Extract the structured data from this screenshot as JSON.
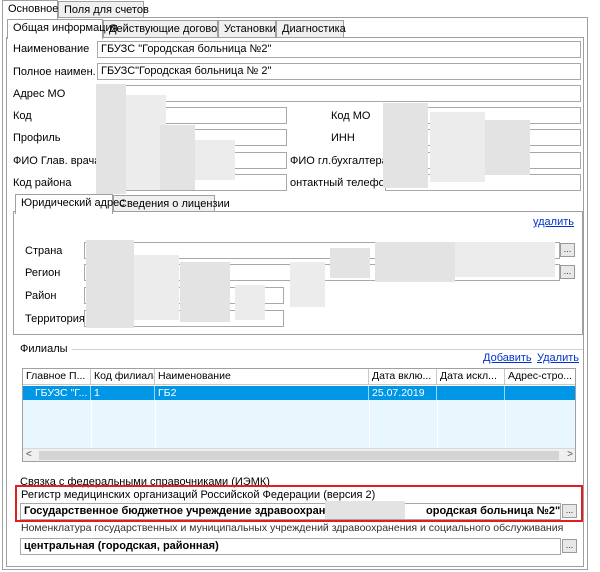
{
  "top_tabs": [
    "Основное",
    "Поля для счетов"
  ],
  "sub_tabs": [
    "Общая информация",
    "Действующие договоры",
    "Установки",
    "Диагностика"
  ],
  "general": {
    "name_label": "Наименование",
    "name_value": "ГБУЗС \"Городская больница №2\"",
    "full_name_label": "Полное наимен.",
    "full_name_value": "ГБУЗС\"Городская больница № 2\"",
    "address_label": "Адрес МО",
    "code_label": "Код",
    "profile_label": "Профиль",
    "chief_label": "ФИО Глав. врача",
    "district_label": "Код района",
    "mo_code_label": "Код МО",
    "inn_label": "ИНН",
    "accountant_label": "ФИО гл.бухгалтера",
    "phone_label": "онтактный телефон"
  },
  "address_tabs": [
    "Юридический адрес",
    "Сведения о лицензии"
  ],
  "address": {
    "delete_link": "удалить",
    "country_label": "Страна",
    "region_label": "Регион",
    "area_label": "Район",
    "territory_label": "Территория"
  },
  "branches": {
    "title": "Филиалы",
    "add_link": "Добавить",
    "delete_link": "Удалить",
    "columns": [
      "Главное П...",
      "Код филиала",
      "Наименование",
      "Дата вклю...",
      "Дата искл...",
      "Адрес-стро..."
    ],
    "rows": [
      [
        "ГБУЗС \"Г...",
        "1",
        "ГБ2",
        "25.07.2019",
        "",
        ""
      ]
    ]
  },
  "iemk": {
    "section_label": "Связка с федеральными справочниками (ИЭМК)",
    "registry_label": "Регистр медицинских организаций Российской Федерации (версия 2)",
    "registry_value_start": "Государственное бюджетное учреждение здравоохранени",
    "registry_value_end": "ородская больница №2\"",
    "nomenclature_label": "Номенклатура государственных и муниципальных учреждений здравоохранения и социального обслуживания",
    "nomenclature_value": "центральная (городская, районная)"
  },
  "ellipsis": "...",
  "arrows": {
    "left": "<",
    "right": ">"
  },
  "colors": {
    "selection": "#0096e6",
    "highlight_box": "#e02020",
    "link": "#0033cc"
  }
}
